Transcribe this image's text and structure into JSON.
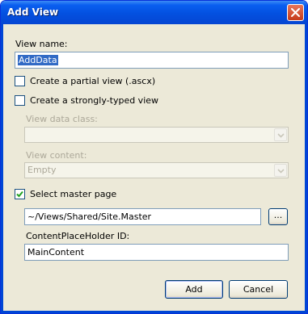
{
  "window": {
    "title": "Add View"
  },
  "view_name": {
    "label": "View name:",
    "value": "AddData"
  },
  "options": {
    "partial_view": {
      "label": "Create a partial view (.ascx)",
      "checked": false
    },
    "strongly_typed": {
      "label": "Create a strongly-typed view",
      "checked": false
    }
  },
  "view_data_class": {
    "label": "View data class:",
    "value": ""
  },
  "view_content": {
    "label": "View content:",
    "value": "Empty"
  },
  "master_page": {
    "label": "Select master page",
    "checked": true,
    "path": "~/Views/Shared/Site.Master",
    "browse_label": "..."
  },
  "content_placeholder": {
    "label": "ContentPlaceHolder ID:",
    "value": "MainContent"
  },
  "buttons": {
    "add": "Add",
    "cancel": "Cancel"
  },
  "colors": {
    "titlebar": "#0a5ff0",
    "frame": "#0046d5",
    "dialog_bg": "#ece9d8",
    "check": "#21a121",
    "selection": "#316ac5"
  }
}
